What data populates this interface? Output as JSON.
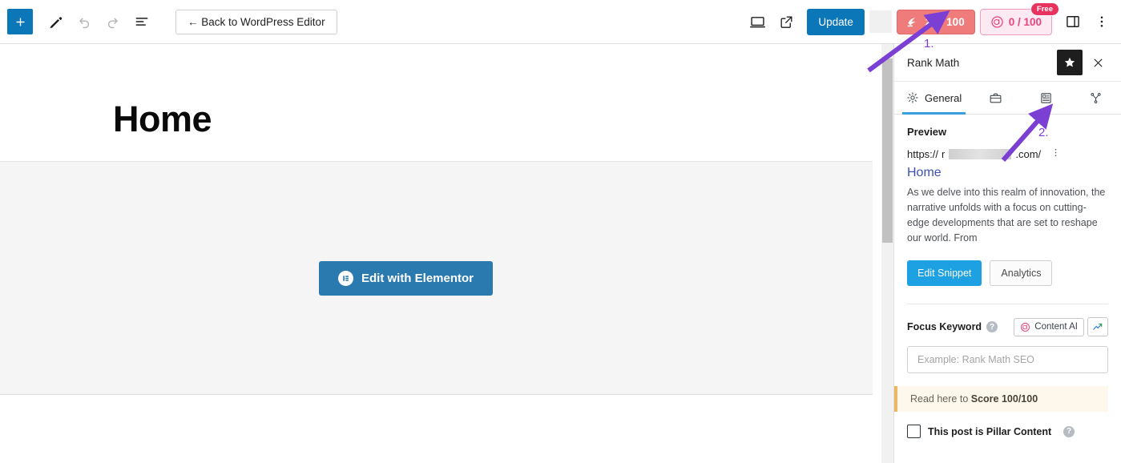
{
  "toolbar": {
    "add_block_label": "+",
    "tools": [
      {
        "name": "add-block-icon",
        "label": "+"
      },
      {
        "name": "edit-tool-icon",
        "label": ""
      },
      {
        "name": "undo-icon",
        "label": ""
      },
      {
        "name": "redo-icon",
        "label": ""
      },
      {
        "name": "document-overview-icon",
        "label": ""
      }
    ],
    "back_button": "← Back to WordPress Editor",
    "preview_icon": "desktop-preview-icon",
    "view_site_icon": "external-link-icon",
    "update_button": "Update",
    "seo_score": "26 / 100",
    "content_ai_score": "0 / 100",
    "free_tag": "Free",
    "settings_sidebar_icon": "sidebar-toggle-icon",
    "options_icon": "kebab-menu-icon"
  },
  "editor": {
    "post_title": "Home",
    "elementor_button": "Edit with Elementor",
    "elementor_logo_letter": "E"
  },
  "rank_math": {
    "panel_title": "Rank Math",
    "star_icon": "star-icon",
    "close_icon": "close-icon",
    "tabs": [
      {
        "label": "General",
        "icon": "gear-icon",
        "active": true
      },
      {
        "label": "",
        "icon": "briefcase-icon",
        "active": false
      },
      {
        "label": "",
        "icon": "schema-document-icon",
        "active": false
      },
      {
        "label": "",
        "icon": "social-share-icon",
        "active": false
      }
    ],
    "preview": {
      "heading": "Preview",
      "url_prefix": "https://",
      "url_visible_char": "r",
      "url_suffix": ".com/",
      "kebab_icon": "kebab-menu-icon",
      "title": "Home",
      "description": "As we delve into this realm of innovation, the narrative unfolds with a focus on cutting-edge developments that are set to reshape our world. From",
      "edit_snippet_button": "Edit Snippet",
      "analytics_button": "Analytics"
    },
    "focus_keyword": {
      "label": "Focus Keyword",
      "help_icon": "help-icon",
      "content_ai_button": "Content AI",
      "content_ai_icon": "content-ai-icon",
      "trends_icon": "trending-up-icon",
      "input_value": "",
      "input_placeholder": "Example: Rank Math SEO"
    },
    "notice": {
      "prefix": "Read here to ",
      "strong": "Score 100/100"
    },
    "pillar": {
      "label": "This post is Pillar Content",
      "checked": false,
      "help_icon": "help-icon"
    }
  },
  "annotations": [
    {
      "number": "1."
    },
    {
      "number": "2."
    }
  ],
  "colors": {
    "wp_blue": "#0b76b8",
    "score_red": "#ef7b7b",
    "content_ai_pink": "#e8457f",
    "free_tag": "#e8335f",
    "rm_blue": "#1da1e3",
    "tab_underline": "#3aa0dd",
    "notice_border": "#eab763",
    "annotation_purple": "#7b3fd4",
    "elementor_blue": "#2a7ab0",
    "snippet_link": "#3c50b1"
  }
}
